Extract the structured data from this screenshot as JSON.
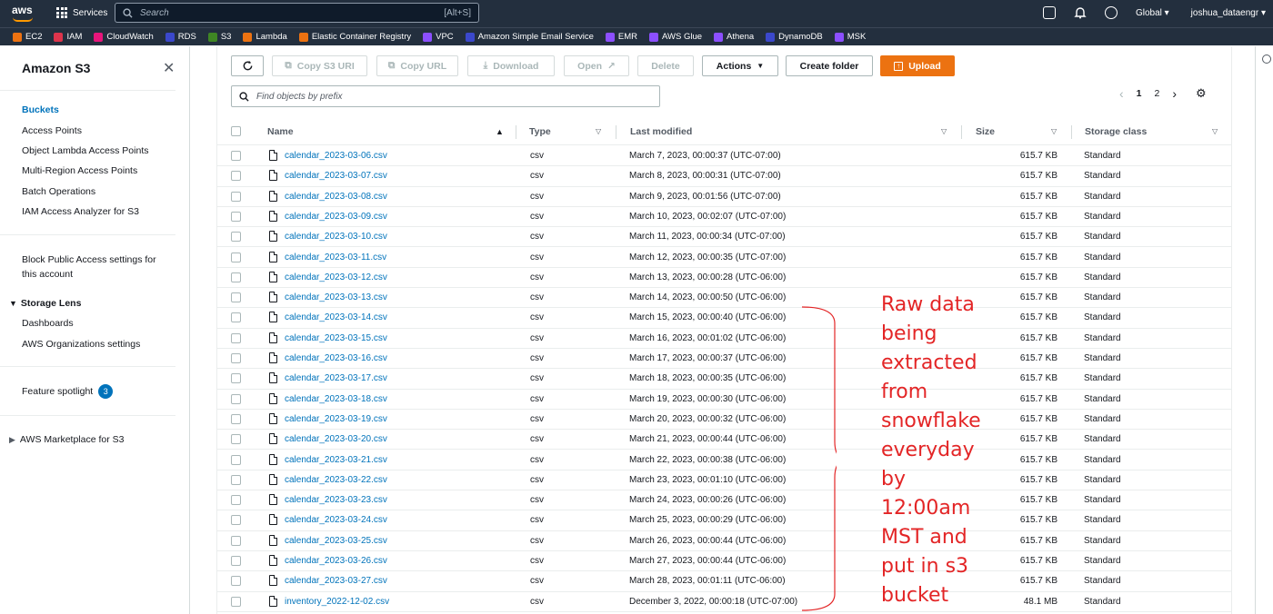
{
  "topnav": {
    "logo": "aws",
    "services_label": "Services",
    "search_placeholder": "Search",
    "search_shortcut": "[Alt+S]",
    "region": "Global",
    "user": "joshua_dataengr"
  },
  "favorites": [
    {
      "label": "EC2",
      "color": "#ec7211"
    },
    {
      "label": "IAM",
      "color": "#dd344c"
    },
    {
      "label": "CloudWatch",
      "color": "#e7157b"
    },
    {
      "label": "RDS",
      "color": "#3b48cc"
    },
    {
      "label": "S3",
      "color": "#3f8624"
    },
    {
      "label": "Lambda",
      "color": "#ec7211"
    },
    {
      "label": "Elastic Container Registry",
      "color": "#ec7211"
    },
    {
      "label": "VPC",
      "color": "#8c4fff"
    },
    {
      "label": "Amazon Simple Email Service",
      "color": "#3b48cc"
    },
    {
      "label": "EMR",
      "color": "#8c4fff"
    },
    {
      "label": "AWS Glue",
      "color": "#8c4fff"
    },
    {
      "label": "Athena",
      "color": "#8c4fff"
    },
    {
      "label": "DynamoDB",
      "color": "#3b48cc"
    },
    {
      "label": "MSK",
      "color": "#8c4fff"
    }
  ],
  "sidebar": {
    "title": "Amazon S3",
    "items": [
      "Buckets",
      "Access Points",
      "Object Lambda Access Points",
      "Multi-Region Access Points",
      "Batch Operations",
      "IAM Access Analyzer for S3"
    ],
    "block_public_1": "Block Public Access settings for",
    "block_public_2": "this account",
    "storage_lens": "Storage Lens",
    "storage_lens_items": [
      "Dashboards",
      "AWS Organizations settings"
    ],
    "feature_spotlight": "Feature spotlight",
    "feature_spotlight_count": "3",
    "marketplace": "AWS Marketplace for S3"
  },
  "toolbar": {
    "copy_s3_uri": "Copy S3 URI",
    "copy_url": "Copy URL",
    "download": "Download",
    "open": "Open",
    "delete": "Delete",
    "actions": "Actions",
    "create_folder": "Create folder",
    "upload": "Upload"
  },
  "find_placeholder": "Find objects by prefix",
  "pager": {
    "page1": "1",
    "page2": "2"
  },
  "columns": [
    "Name",
    "Type",
    "Last modified",
    "Size",
    "Storage class"
  ],
  "rows": [
    {
      "name": "calendar_2023-03-06.csv",
      "type": "csv",
      "modified": "March 7, 2023, 00:00:37 (UTC-07:00)",
      "size": "615.7 KB",
      "class": "Standard"
    },
    {
      "name": "calendar_2023-03-07.csv",
      "type": "csv",
      "modified": "March 8, 2023, 00:00:31 (UTC-07:00)",
      "size": "615.7 KB",
      "class": "Standard"
    },
    {
      "name": "calendar_2023-03-08.csv",
      "type": "csv",
      "modified": "March 9, 2023, 00:01:56 (UTC-07:00)",
      "size": "615.7 KB",
      "class": "Standard"
    },
    {
      "name": "calendar_2023-03-09.csv",
      "type": "csv",
      "modified": "March 10, 2023, 00:02:07 (UTC-07:00)",
      "size": "615.7 KB",
      "class": "Standard"
    },
    {
      "name": "calendar_2023-03-10.csv",
      "type": "csv",
      "modified": "March 11, 2023, 00:00:34 (UTC-07:00)",
      "size": "615.7 KB",
      "class": "Standard"
    },
    {
      "name": "calendar_2023-03-11.csv",
      "type": "csv",
      "modified": "March 12, 2023, 00:00:35 (UTC-07:00)",
      "size": "615.7 KB",
      "class": "Standard"
    },
    {
      "name": "calendar_2023-03-12.csv",
      "type": "csv",
      "modified": "March 13, 2023, 00:00:28 (UTC-06:00)",
      "size": "615.7 KB",
      "class": "Standard"
    },
    {
      "name": "calendar_2023-03-13.csv",
      "type": "csv",
      "modified": "March 14, 2023, 00:00:50 (UTC-06:00)",
      "size": "615.7 KB",
      "class": "Standard"
    },
    {
      "name": "calendar_2023-03-14.csv",
      "type": "csv",
      "modified": "March 15, 2023, 00:00:40 (UTC-06:00)",
      "size": "615.7 KB",
      "class": "Standard"
    },
    {
      "name": "calendar_2023-03-15.csv",
      "type": "csv",
      "modified": "March 16, 2023, 00:01:02 (UTC-06:00)",
      "size": "615.7 KB",
      "class": "Standard"
    },
    {
      "name": "calendar_2023-03-16.csv",
      "type": "csv",
      "modified": "March 17, 2023, 00:00:37 (UTC-06:00)",
      "size": "615.7 KB",
      "class": "Standard"
    },
    {
      "name": "calendar_2023-03-17.csv",
      "type": "csv",
      "modified": "March 18, 2023, 00:00:35 (UTC-06:00)",
      "size": "615.7 KB",
      "class": "Standard"
    },
    {
      "name": "calendar_2023-03-18.csv",
      "type": "csv",
      "modified": "March 19, 2023, 00:00:30 (UTC-06:00)",
      "size": "615.7 KB",
      "class": "Standard"
    },
    {
      "name": "calendar_2023-03-19.csv",
      "type": "csv",
      "modified": "March 20, 2023, 00:00:32 (UTC-06:00)",
      "size": "615.7 KB",
      "class": "Standard"
    },
    {
      "name": "calendar_2023-03-20.csv",
      "type": "csv",
      "modified": "March 21, 2023, 00:00:44 (UTC-06:00)",
      "size": "615.7 KB",
      "class": "Standard"
    },
    {
      "name": "calendar_2023-03-21.csv",
      "type": "csv",
      "modified": "March 22, 2023, 00:00:38 (UTC-06:00)",
      "size": "615.7 KB",
      "class": "Standard"
    },
    {
      "name": "calendar_2023-03-22.csv",
      "type": "csv",
      "modified": "March 23, 2023, 00:01:10 (UTC-06:00)",
      "size": "615.7 KB",
      "class": "Standard"
    },
    {
      "name": "calendar_2023-03-23.csv",
      "type": "csv",
      "modified": "March 24, 2023, 00:00:26 (UTC-06:00)",
      "size": "615.7 KB",
      "class": "Standard"
    },
    {
      "name": "calendar_2023-03-24.csv",
      "type": "csv",
      "modified": "March 25, 2023, 00:00:29 (UTC-06:00)",
      "size": "615.7 KB",
      "class": "Standard"
    },
    {
      "name": "calendar_2023-03-25.csv",
      "type": "csv",
      "modified": "March 26, 2023, 00:00:44 (UTC-06:00)",
      "size": "615.7 KB",
      "class": "Standard"
    },
    {
      "name": "calendar_2023-03-26.csv",
      "type": "csv",
      "modified": "March 27, 2023, 00:00:44 (UTC-06:00)",
      "size": "615.7 KB",
      "class": "Standard"
    },
    {
      "name": "calendar_2023-03-27.csv",
      "type": "csv",
      "modified": "March 28, 2023, 00:01:11 (UTC-06:00)",
      "size": "615.7 KB",
      "class": "Standard"
    },
    {
      "name": "inventory_2022-12-02.csv",
      "type": "csv",
      "modified": "December 3, 2022, 00:00:18 (UTC-07:00)",
      "size": "48.1 MB",
      "class": "Standard"
    }
  ],
  "annotation": {
    "lines": [
      "Raw data",
      "being",
      "extracted",
      "from",
      "snowflake",
      "everyday",
      "by",
      "12:00am",
      "MST and",
      "put in s3",
      "bucket"
    ],
    "color": "#e32526"
  }
}
